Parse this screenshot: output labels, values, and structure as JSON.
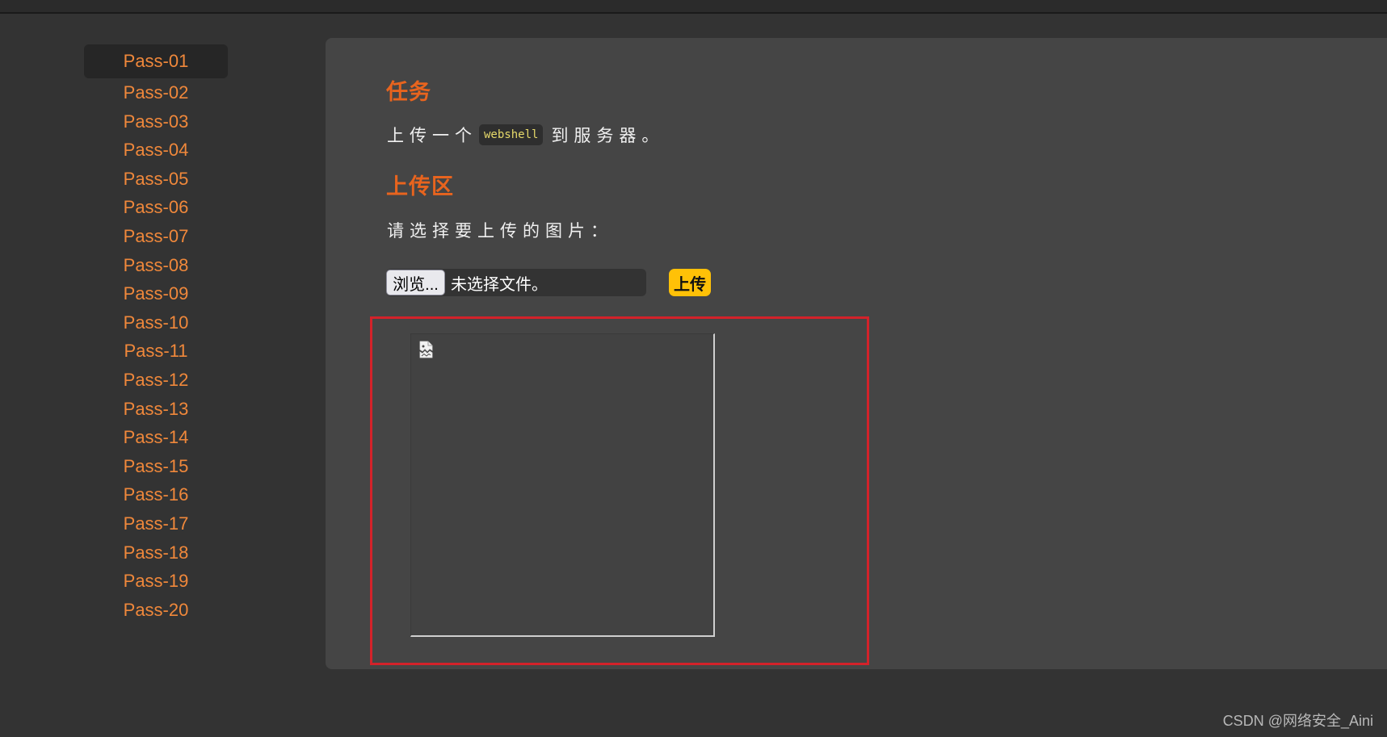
{
  "sidebar": {
    "items": [
      {
        "label": "Pass-01",
        "active": true
      },
      {
        "label": "Pass-02"
      },
      {
        "label": "Pass-03"
      },
      {
        "label": "Pass-04"
      },
      {
        "label": "Pass-05"
      },
      {
        "label": "Pass-06"
      },
      {
        "label": "Pass-07"
      },
      {
        "label": "Pass-08"
      },
      {
        "label": "Pass-09"
      },
      {
        "label": "Pass-10"
      },
      {
        "label": "Pass-11"
      },
      {
        "label": "Pass-12"
      },
      {
        "label": "Pass-13"
      },
      {
        "label": "Pass-14"
      },
      {
        "label": "Pass-15"
      },
      {
        "label": "Pass-16"
      },
      {
        "label": "Pass-17"
      },
      {
        "label": "Pass-18"
      },
      {
        "label": "Pass-19"
      },
      {
        "label": "Pass-20"
      }
    ]
  },
  "task": {
    "heading": "任务",
    "text_before": "上传一个",
    "code": "webshell",
    "text_after": "到服务器。"
  },
  "upload": {
    "heading": "上传区",
    "prompt": "请选择要上传的图片：",
    "browse_label": "浏览...",
    "file_status": "未选择文件。",
    "submit_label": "上传"
  },
  "preview": {
    "icon": "broken-image-icon"
  },
  "watermark": "CSDN @网络安全_Aini",
  "colors": {
    "background": "#333333",
    "panel": "#454545",
    "link": "#f0883b",
    "heading": "#e8641e",
    "upload_button": "#ffc107",
    "highlight_border": "#d3222a"
  }
}
